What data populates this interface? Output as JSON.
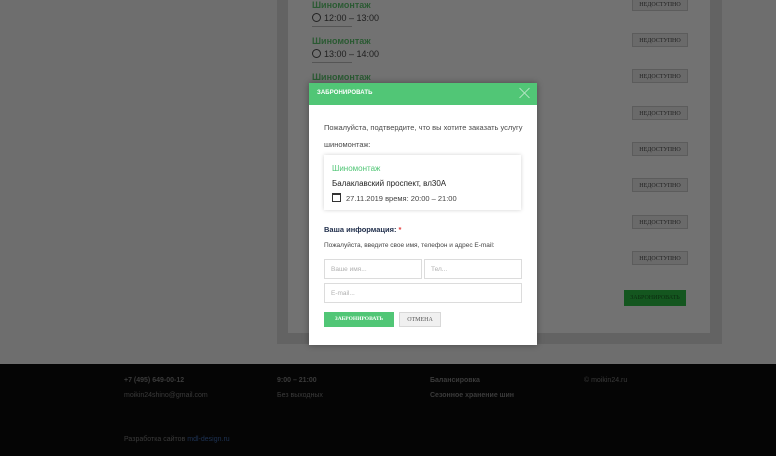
{
  "schedule": {
    "slots": [
      {
        "title": "Шиномонтаж",
        "time": "12:00 – 13:00"
      },
      {
        "title": "Шиномонтаж",
        "time": "13:00 – 14:00"
      },
      {
        "title": "Шиномонтаж",
        "time": ""
      }
    ],
    "unavailable_label": "НЕДОСТУПНО",
    "book_label": "ЗАБРОНИРОВАТЬ"
  },
  "footer": {
    "phone": "+7 (495) 649-00-12",
    "email": "moikin24shino@gmail.com",
    "hours": "9:00 – 21:00",
    "days": "Без выходных",
    "link1": "Балансировка",
    "link2": "Сезонное хранение шин",
    "copyright": "© moikin24.ru",
    "dev_prefix": "Разработка сайтов",
    "dev_link": "mdl-design.ru"
  },
  "modal": {
    "title": "ЗАБРОНИРОВАТЬ",
    "confirm_text": "Пожалуйста, подтвердите, что вы хотите заказать услугу шиномонтаж:",
    "service": {
      "name": "Шиномонтаж",
      "address": "Балаклавский проспект, вл30А",
      "date": "27.11.2019 время: 20:00 – 21:00"
    },
    "info_label": "Ваша информация:",
    "required_mark": "*",
    "info_hint": "Пожалуйста, введите свое имя, телефон и адрес E-mail:",
    "fields": {
      "name_placeholder": "Ваше имя...",
      "phone_placeholder": "Тел...",
      "email_placeholder": "E-mail..."
    },
    "submit_label": "ЗАБРОНИРОВАТЬ",
    "cancel_label": "ОТМЕНА"
  }
}
